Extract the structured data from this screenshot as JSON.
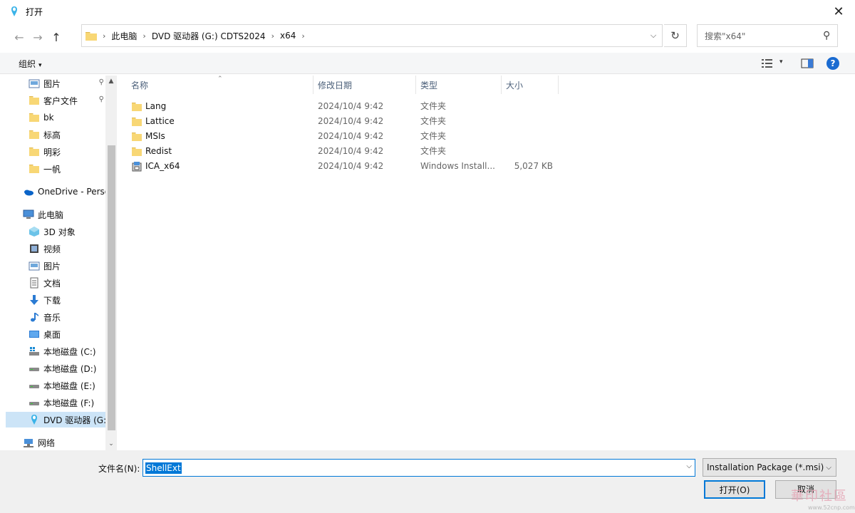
{
  "window": {
    "title": "打开",
    "close_label": "✕"
  },
  "nav": {
    "back": "←",
    "forward": "→",
    "up": "↑"
  },
  "address": {
    "crumbs": [
      "此电脑",
      "DVD 驱动器 (G:) CDTS2024",
      "x64"
    ],
    "sep": "›",
    "dropdown": "⌵",
    "refresh": "↻"
  },
  "search": {
    "placeholder": "搜索\"x64\"",
    "icon": "⚲"
  },
  "toolbar": {
    "organize": "组织",
    "caret": "▾",
    "help": "?"
  },
  "navpane": {
    "items": [
      {
        "label": "图片",
        "icon": "pictures-icon",
        "pinned": true
      },
      {
        "label": "客户文件",
        "icon": "folder-icon",
        "pinned": true
      },
      {
        "label": "bk",
        "icon": "folder-icon"
      },
      {
        "label": "标高",
        "icon": "folder-icon"
      },
      {
        "label": "明彩",
        "icon": "folder-icon"
      },
      {
        "label": "一帆",
        "icon": "folder-icon"
      },
      {
        "label": "OneDrive - Perso",
        "icon": "onedrive-icon"
      },
      {
        "label": "此电脑",
        "icon": "computer-icon"
      },
      {
        "label": "3D 对象",
        "icon": "3d-objects-icon"
      },
      {
        "label": "视频",
        "icon": "video-icon"
      },
      {
        "label": "图片",
        "icon": "pictures-icon"
      },
      {
        "label": "文档",
        "icon": "documents-icon"
      },
      {
        "label": "下载",
        "icon": "download-icon"
      },
      {
        "label": "音乐",
        "icon": "music-icon"
      },
      {
        "label": "桌面",
        "icon": "desktop-icon"
      },
      {
        "label": "本地磁盘 (C:)",
        "icon": "system-drive-icon"
      },
      {
        "label": "本地磁盘 (D:)",
        "icon": "drive-icon"
      },
      {
        "label": "本地磁盘 (E:)",
        "icon": "drive-icon"
      },
      {
        "label": "本地磁盘 (F:)",
        "icon": "drive-icon"
      },
      {
        "label": "DVD 驱动器 (G:",
        "icon": "dvd-icon",
        "selected": true
      },
      {
        "label": "网络",
        "icon": "network-icon"
      }
    ],
    "pin_glyph": "📌",
    "scroll_up": "▲",
    "scroll_down": "⌄"
  },
  "columns": {
    "name": "名称",
    "date": "修改日期",
    "type": "类型",
    "size": "大小",
    "sort": "⌃"
  },
  "files": [
    {
      "name": "Lang",
      "date": "2024/10/4 9:42",
      "type": "文件夹",
      "size": "",
      "icon": "folder-icon"
    },
    {
      "name": "Lattice",
      "date": "2024/10/4 9:42",
      "type": "文件夹",
      "size": "",
      "icon": "folder-icon"
    },
    {
      "name": "MSIs",
      "date": "2024/10/4 9:42",
      "type": "文件夹",
      "size": "",
      "icon": "folder-icon"
    },
    {
      "name": "Redist",
      "date": "2024/10/4 9:42",
      "type": "文件夹",
      "size": "",
      "icon": "folder-icon"
    },
    {
      "name": "ICA_x64",
      "date": "2024/10/4 9:42",
      "type": "Windows Install...",
      "size": "5,027 KB",
      "icon": "msi-icon"
    }
  ],
  "bottom": {
    "filename_label": "文件名(N):",
    "filename_value": "ShellExt",
    "filename_dd": "⌵",
    "filter": "Installation Package (*.msi)",
    "filter_dd": "⌵",
    "open": "打开(O)",
    "cancel": "取消"
  },
  "watermark": {
    "text": "華印社區",
    "url": "www.52cnp.com"
  },
  "colors": {
    "accent": "#0078d7",
    "selected": "#cce4f7",
    "folder": "#f8d775"
  }
}
